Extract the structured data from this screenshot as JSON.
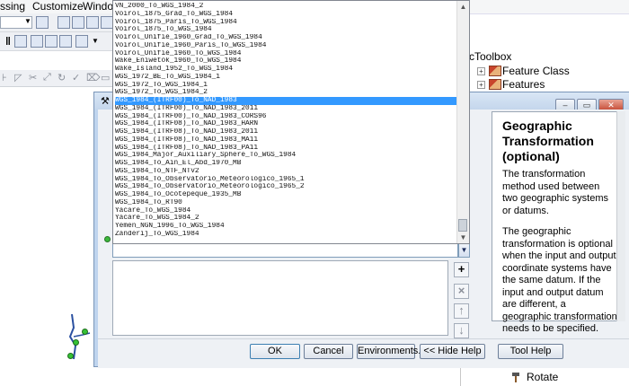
{
  "menubar": {
    "items": [
      "ssing",
      "Customize",
      "Window"
    ]
  },
  "toolbox": {
    "title": "cToolbox",
    "items": [
      {
        "label": "Feature Class",
        "expander": "+"
      },
      {
        "label": "Features",
        "expander": "+"
      }
    ],
    "bottom_item": "Rotate"
  },
  "dropdown": {
    "items": [
      "VN_2000_To_WGS_1984_2",
      "Voirol_1875_Grad_To_WGS_1984",
      "Voirol_1875_Paris_To_WGS_1984",
      "Voirol_1875_To_WGS_1984",
      "Voirol_Unifie_1960_Grad_To_WGS_1984",
      "Voirol_Unifie_1960_Paris_To_WGS_1984",
      "Voirol_Unifie_1960_To_WGS_1984",
      "Wake_Eniwetok_1960_To_WGS_1984",
      "Wake_Island_1952_To_WGS_1984",
      "WGS_1972_BE_To_WGS_1984_1",
      "WGS_1972_To_WGS_1984_1",
      "WGS_1972_To_WGS_1984_2",
      "WGS_1984_(ITRF00)_To_NAD_1983",
      "WGS_1984_(ITRF00)_To_NAD_1983_2011",
      "WGS_1984_(ITRF00)_To_NAD_1983_CORS96",
      "WGS_1984_(ITRF08)_To_NAD_1983_HARN",
      "WGS_1984_(ITRF08)_To_NAD_1983_2011",
      "WGS_1984_(ITRF08)_To_NAD_1983_MA11",
      "WGS_1984_(ITRF08)_To_NAD_1983_PA11",
      "WGS_1984_Major_Auxiliary_Sphere_To_WGS_1984",
      "WGS_1984_To_Ain_El_Abd_1970_MB",
      "WGS_1984_To_NTF_NTv2",
      "WGS_1984_To_Observatorio_Meteorologico_1965_1",
      "WGS_1984_To_Observatorio_Meteorologico_1965_2",
      "WGS_1984_To_Ocotepeque_1935_MB",
      "WGS_1984_To_RT90",
      "Yacare_To_WGS_1984",
      "Yacare_To_WGS_1984_2",
      "Yemen_NGN_1996_To_WGS_1984",
      "Zanderij_To_WGS_1984"
    ],
    "selected_index": 12
  },
  "combo": {
    "value": ""
  },
  "help": {
    "title": "Geographic Transformation (optional)",
    "paragraph1": "The transformation method used between two geographic systems or datums.",
    "paragraph2": "The geographic transformation is optional when the input and output coordinate systems have the same datum. If the input and output datum are different, a geographic transformation needs to be specified."
  },
  "side_buttons": [
    "+",
    "×",
    "↑",
    "↓"
  ],
  "buttons": {
    "ok": "OK",
    "cancel": "Cancel",
    "environments": "Environments...",
    "hide_help": "<< Hide Help",
    "tool_help": "Tool Help"
  },
  "window_controls": [
    "–",
    "▭",
    "✕"
  ]
}
